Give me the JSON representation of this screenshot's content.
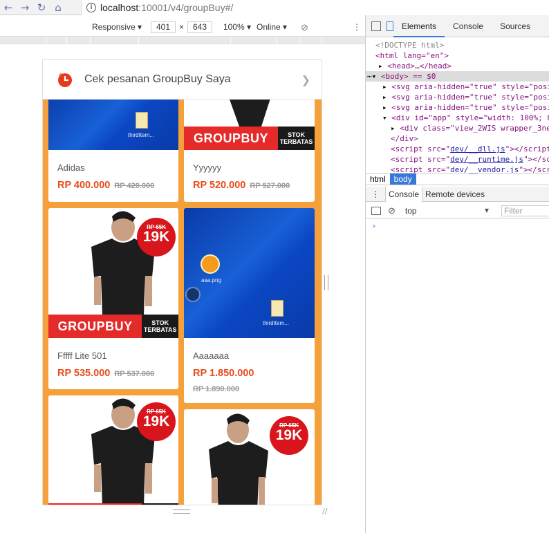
{
  "browser": {
    "url_host": "localhost",
    "url_rest": ":10001/v4/groupBuy#/",
    "info_glyph": "i"
  },
  "device_toolbar": {
    "mode": "Responsive",
    "width": "401",
    "times": "×",
    "height": "643",
    "zoom": "100%",
    "network": "Online"
  },
  "app": {
    "header_title": "Cek pesanan GroupBuy Saya",
    "products": [
      {
        "name": "Adidas",
        "price": "RP 400.000",
        "old_price": "RP 420.000",
        "image": "blue-desktop",
        "file_label": "thirdItem..."
      },
      {
        "name": "Yyyyyy",
        "price": "RP 520.000",
        "old_price": "RP 527.000",
        "image": "groupbuy-banner"
      },
      {
        "name": "Fffff Lite 501",
        "price": "RP 535.000",
        "old_price": "RP 537.000",
        "image": "tshirt-19k"
      },
      {
        "name": "Aaaaaaa",
        "price": "RP 1.850.000",
        "old_price": "RP 1.890.000",
        "image": "blue-desktop",
        "file_label": "thirdItem...",
        "icon_label": "aaa.png"
      },
      {
        "image": "tshirt-19k"
      },
      {
        "image": "tshirt-19k"
      }
    ],
    "banner_main": "GROUPBUY",
    "banner_side_line1": "STOK",
    "banner_side_line2": "TERBATAS",
    "badge_rp": "RP 65K",
    "badge_big": "19K"
  },
  "devtools": {
    "tabs": [
      "Elements",
      "Console",
      "Sources"
    ],
    "active_tab": "Elements",
    "crumbs": [
      "html",
      "body"
    ],
    "drawer_tabs": [
      "Console",
      "Remote devices"
    ],
    "context": "top",
    "filter_placeholder": "Filter",
    "prompt": "›",
    "dom": {
      "doctype": "<!DOCTYPE html>",
      "html_open": "<html lang=\"en\">",
      "head": "<head>…</head>",
      "body_sel": "<body> == $0",
      "svg1": "<svg aria-hidden=\"true\" style=\"posi",
      "svg2": "<svg aria-hidden=\"true\" style=\"posi",
      "svg3": "<svg aria-hidden=\"true\" style=\"posi",
      "app_div": "<div id=\"app\" style=\"width: 100%; h",
      "inner_div": "<div class=\"view_2WIS wrapper_3ne",
      "close_div": "</div>",
      "script1_pre": "<script src=\"",
      "script1_link": "dev/__dll.js",
      "script1_post": "\"></script",
      "script2_link": "dev/__runtime.js",
      "script2_post": "\"></sc",
      "script3_link": "dev/__vendor.js",
      "script3_post": "\"></scr"
    }
  }
}
